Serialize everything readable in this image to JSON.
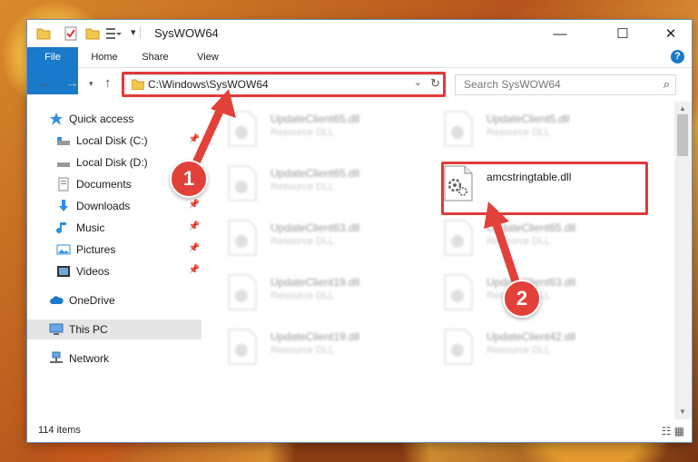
{
  "window": {
    "title": "SysWOW64"
  },
  "titlebar": {
    "minimize": "—",
    "maximize": "☐",
    "close": "✕"
  },
  "ribbon": {
    "tabs": [
      "File",
      "Home",
      "Share",
      "View"
    ],
    "help": "?"
  },
  "address": {
    "path": "C:\\Windows\\SysWOW64"
  },
  "search": {
    "placeholder": "Search SysWOW64"
  },
  "nav": {
    "items": [
      {
        "label": "Quick access",
        "icon": "star-icon"
      },
      {
        "label": "Local Disk (C:)",
        "icon": "drive-icon",
        "pinned": true
      },
      {
        "label": "Local Disk (D:)",
        "icon": "drive-icon"
      },
      {
        "label": "Documents",
        "icon": "documents-icon"
      },
      {
        "label": "Downloads",
        "icon": "downloads-icon",
        "pinned": true
      },
      {
        "label": "Music",
        "icon": "music-icon",
        "pinned": true
      },
      {
        "label": "Pictures",
        "icon": "pictures-icon",
        "pinned": true
      },
      {
        "label": "Videos",
        "icon": "videos-icon",
        "pinned": true
      },
      {
        "label": "OneDrive",
        "icon": "cloud-icon"
      },
      {
        "label": "This PC",
        "icon": "computer-icon",
        "selected": true
      },
      {
        "label": "Network",
        "icon": "network-icon"
      }
    ]
  },
  "files": {
    "left": [
      {
        "name": "UpdateClient65.dll",
        "type": "Resource DLL"
      },
      {
        "name": "UpdateClient65.dll",
        "type": "Resource DLL"
      },
      {
        "name": "UpdateClient63.dll",
        "type": "Resource DLL"
      },
      {
        "name": "UpdateClient19.dll",
        "type": "Resource DLL"
      },
      {
        "name": "UpdateClient19.dll",
        "type": "Resource DLL"
      }
    ],
    "right": [
      {
        "name": "UpdateClient5.dll",
        "type": "Resource DLL"
      },
      {
        "name": "amcstringtable.dll",
        "type": "",
        "highlighted": true
      },
      {
        "name": "UpdateClient65.dll",
        "type": "Resource DLL"
      },
      {
        "name": "UpdateClient63.dll",
        "type": "Resource DLL"
      },
      {
        "name": "UpdateClient42.dll",
        "type": "Resource DLL"
      }
    ]
  },
  "status": {
    "item_count": "114 items"
  },
  "badges": {
    "one": "1",
    "two": "2"
  },
  "colors": {
    "accent": "#1979ca",
    "highlight": "#e03a3a"
  }
}
